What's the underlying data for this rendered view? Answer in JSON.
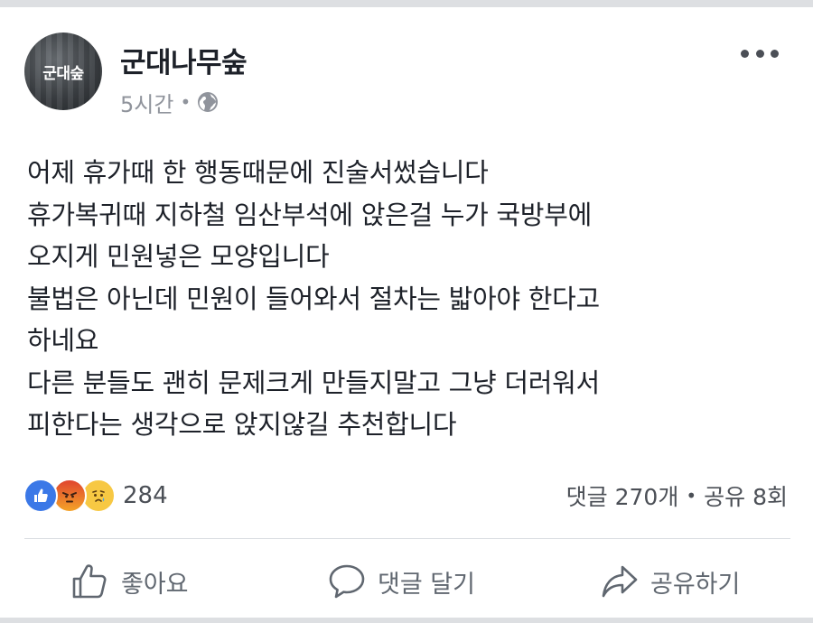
{
  "post": {
    "page_name": "군대나무숲",
    "avatar_text": "군대숲",
    "time": "5시간",
    "meta_dot": "•",
    "privacy_icon": "globe-icon",
    "more_icon": "more-options-icon",
    "lines": [
      "어제 휴가때 한 행동때문에 진술서썼습니다",
      "휴가복귀때 지하철 임산부석에 앉은걸 누가 국방부에",
      "오지게 민원넣은 모양입니다",
      "불법은 아닌데 민원이 들어와서 절차는 밟아야 한다고",
      "하네요",
      "다른 분들도 괜히 문제크게 만들지말고 그냥 더러워서",
      "피한다는 생각으로 앉지않길 추천합니다"
    ]
  },
  "engagement": {
    "reaction_icons": [
      "like-reaction-icon",
      "angry-reaction-icon",
      "sad-reaction-icon"
    ],
    "reaction_count": "284",
    "comments": "댓글 270개",
    "separator": "•",
    "shares": "공유 8회"
  },
  "actions": {
    "like_label": "좋아요",
    "comment_label": "댓글 달기",
    "share_label": "공유하기"
  },
  "colors": {
    "name": "#1d2129",
    "meta": "#90949c",
    "action": "#606770",
    "like_blue": "#3b78e7"
  }
}
